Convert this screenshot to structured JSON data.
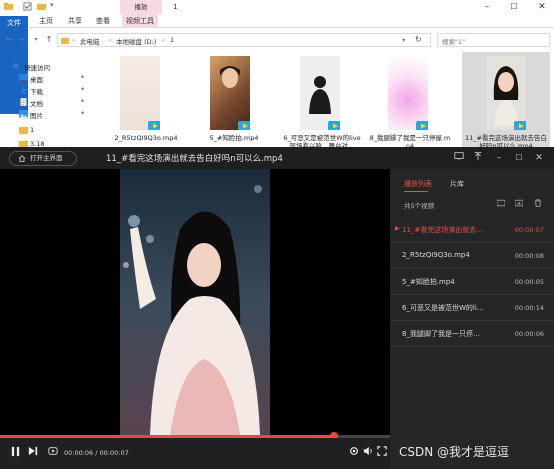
{
  "explorer": {
    "title": "1",
    "tools_tab": "播放",
    "ribbon_tabs": [
      "文件",
      "主页",
      "共享",
      "查看",
      "视频工具"
    ],
    "breadcrumb": [
      "此电脑",
      "本地磁盘 (D:)",
      "1"
    ],
    "search_placeholder": "搜索\"1\"",
    "nav_items": [
      {
        "label": "快速访问",
        "icon": "star-icon",
        "pinned": false
      },
      {
        "label": "桌面",
        "icon": "desktop-icon",
        "pinned": true
      },
      {
        "label": "下载",
        "icon": "download-icon",
        "pinned": true
      },
      {
        "label": "文档",
        "icon": "document-icon",
        "pinned": true
      },
      {
        "label": "图片",
        "icon": "picture-icon",
        "pinned": true
      },
      {
        "label": "1",
        "icon": "folder-icon",
        "pinned": false
      },
      {
        "label": "3.18",
        "icon": "folder-icon",
        "pinned": false
      }
    ],
    "files": [
      {
        "name": "2_R5tzQI9Q3o.mp4",
        "selected": false
      },
      {
        "name": "5_#知脸拍.mp4",
        "selected": false
      },
      {
        "name": "6_可恶又是被范世W的live 现场看兴哈…舞台对…",
        "selected": false
      },
      {
        "name": "8_我腿脚了我是一只停屋.mp4",
        "selected": false
      },
      {
        "name": "11_#看完这场演出就去告白好吗n可以么.mp4",
        "selected": true
      }
    ]
  },
  "player": {
    "open_main_label": "打开主界面",
    "title": "11_#看完这场演出就去告白好吗n可以么.mp4",
    "current_time": "00:00:06",
    "total_time": "00:00:07",
    "progress": 0.857,
    "playlist_tabs": [
      "播放列表",
      "片库"
    ],
    "playlist_count": "共5个视频",
    "playlist": [
      {
        "name": "11_#看完这场演出就去…",
        "duration": "00:00:07",
        "active": true
      },
      {
        "name": "2_R5tzQI9Q3o.mp4",
        "duration": "00:00:08",
        "active": false
      },
      {
        "name": "5_#知脸拍.mp4",
        "duration": "00:00:05",
        "active": false
      },
      {
        "name": "6_可恶又是被范世W的li…",
        "duration": "00:00:14",
        "active": false
      },
      {
        "name": "8_我腿脚了我是一只停…",
        "duration": "00:00:06",
        "active": false
      }
    ]
  },
  "watermark": "CSDN @我才是逗逗",
  "colors": {
    "accent": "#e8533e",
    "player_bg": "#1d1d1f",
    "file_tab": "#1a63c1",
    "tool_tab": "#f7d9e6"
  }
}
